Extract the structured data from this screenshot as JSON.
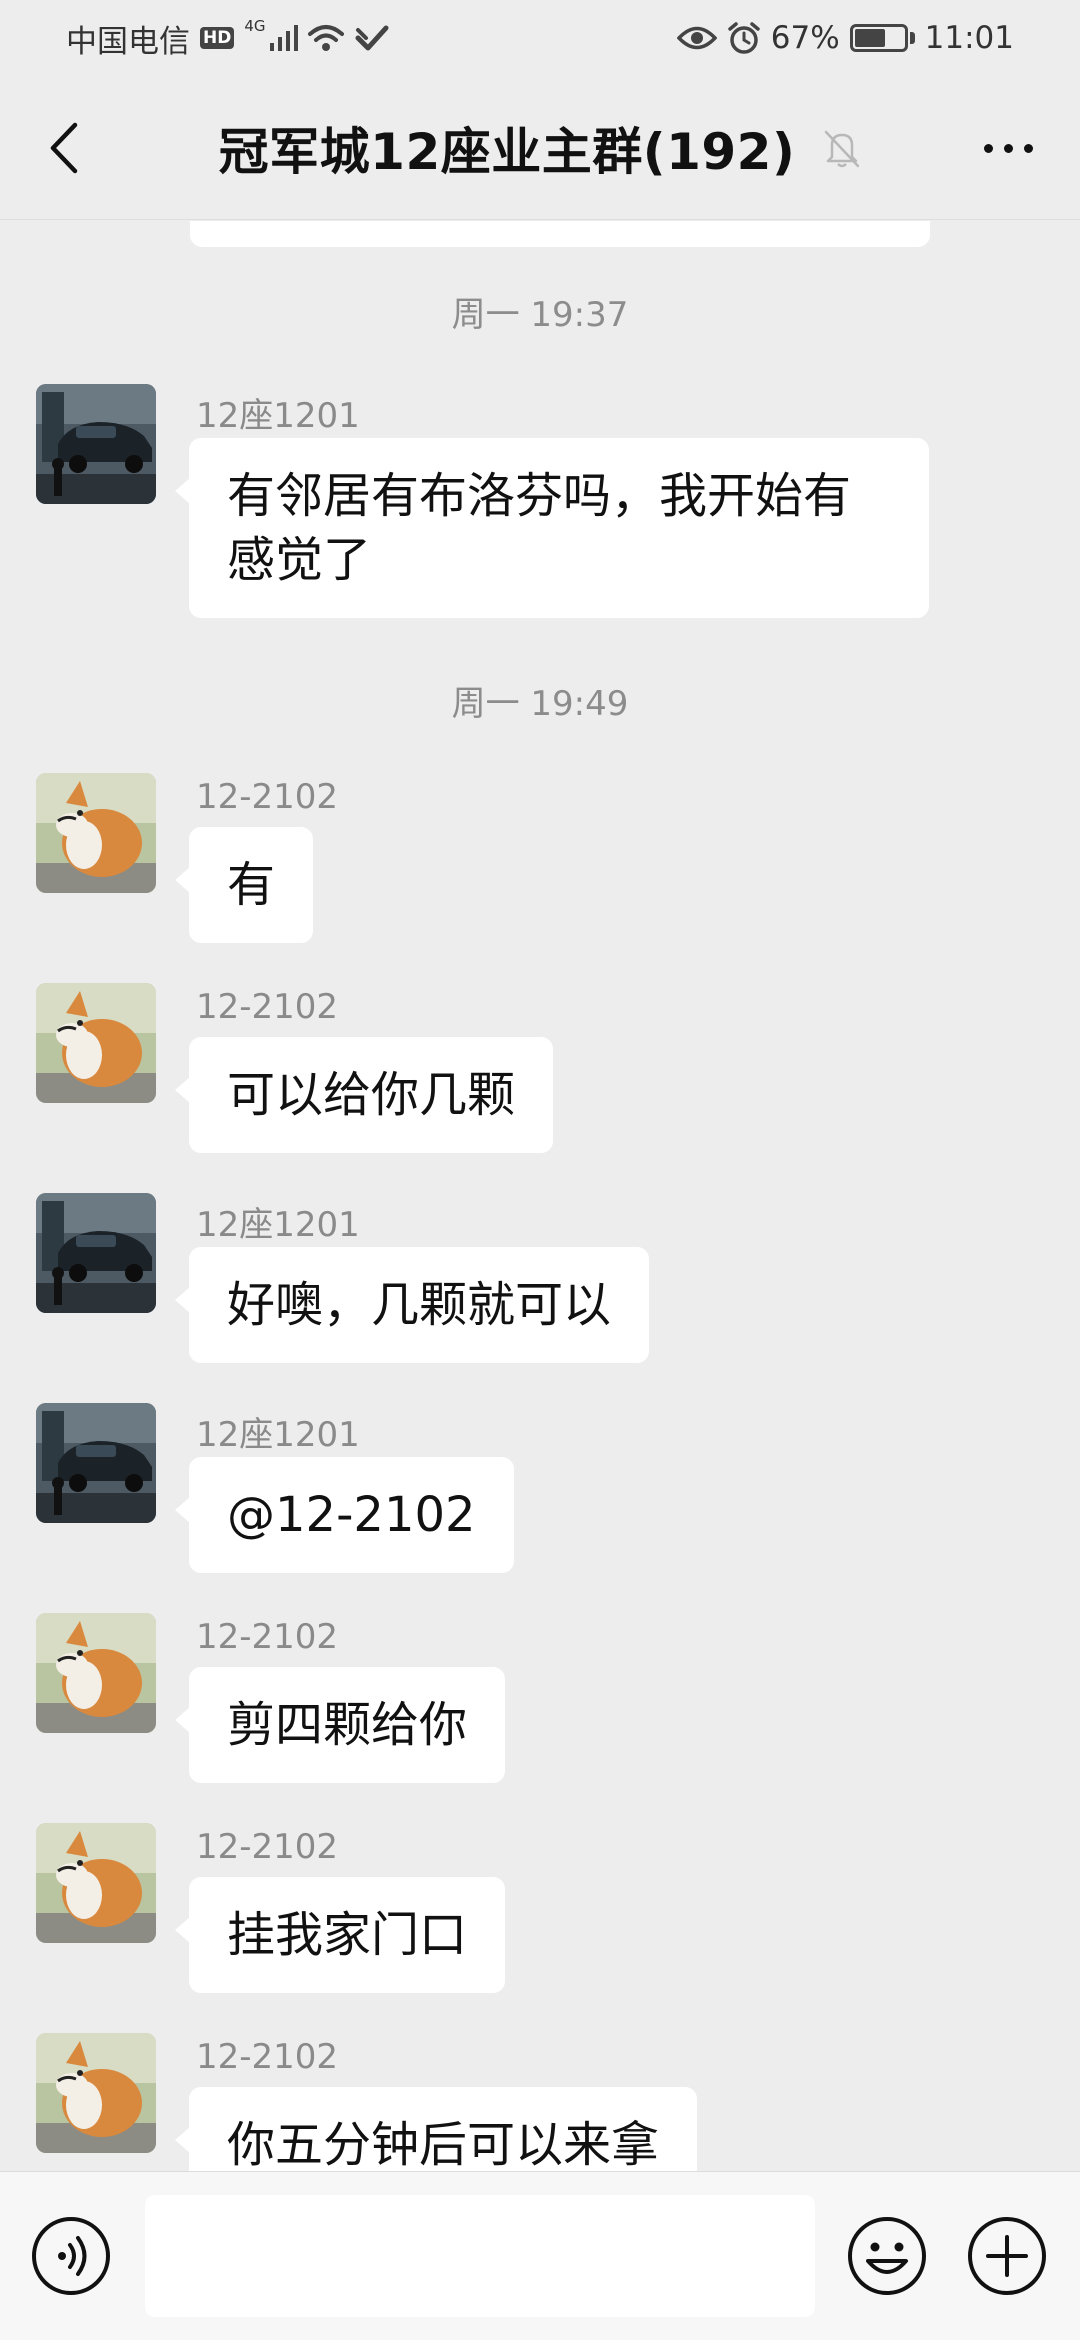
{
  "status_bar": {
    "carrier": "中国电信",
    "hd_badge": "HD",
    "network_type": "4G",
    "battery_percent": "67%",
    "battery_level": 0.67,
    "time": "11:01"
  },
  "header": {
    "title": "冠军城12座业主群(192)",
    "muted": true
  },
  "chat": {
    "timestamps": [
      "周一 19:37",
      "周一 19:49"
    ],
    "messages": [
      {
        "sender": "12座1201",
        "text": "有邻居有布洛芬吗，我开始有感觉了",
        "avatar": "car-avatar"
      },
      {
        "sender": "12-2102",
        "text": "有",
        "avatar": "corgi-avatar"
      },
      {
        "sender": "12-2102",
        "text": "可以给你几颗",
        "avatar": "corgi-avatar"
      },
      {
        "sender": "12座1201",
        "text": "好噢，几颗就可以",
        "avatar": "car-avatar"
      },
      {
        "sender": "12座1201",
        "text": "@12-2102",
        "avatar": "car-avatar"
      },
      {
        "sender": "12-2102",
        "text": "剪四颗给你",
        "avatar": "corgi-avatar"
      },
      {
        "sender": "12-2102",
        "text": "挂我家门口",
        "avatar": "corgi-avatar"
      },
      {
        "sender": "12-2102",
        "text": "你五分钟后可以来拿",
        "avatar": "corgi-avatar"
      }
    ]
  },
  "input_bar": {
    "value": "",
    "icons": [
      "voice-icon",
      "emoji-icon",
      "plus-icon"
    ]
  },
  "colors": {
    "background": "#ededed",
    "bubble": "#ffffff",
    "meta_text": "#8c8c8c"
  }
}
